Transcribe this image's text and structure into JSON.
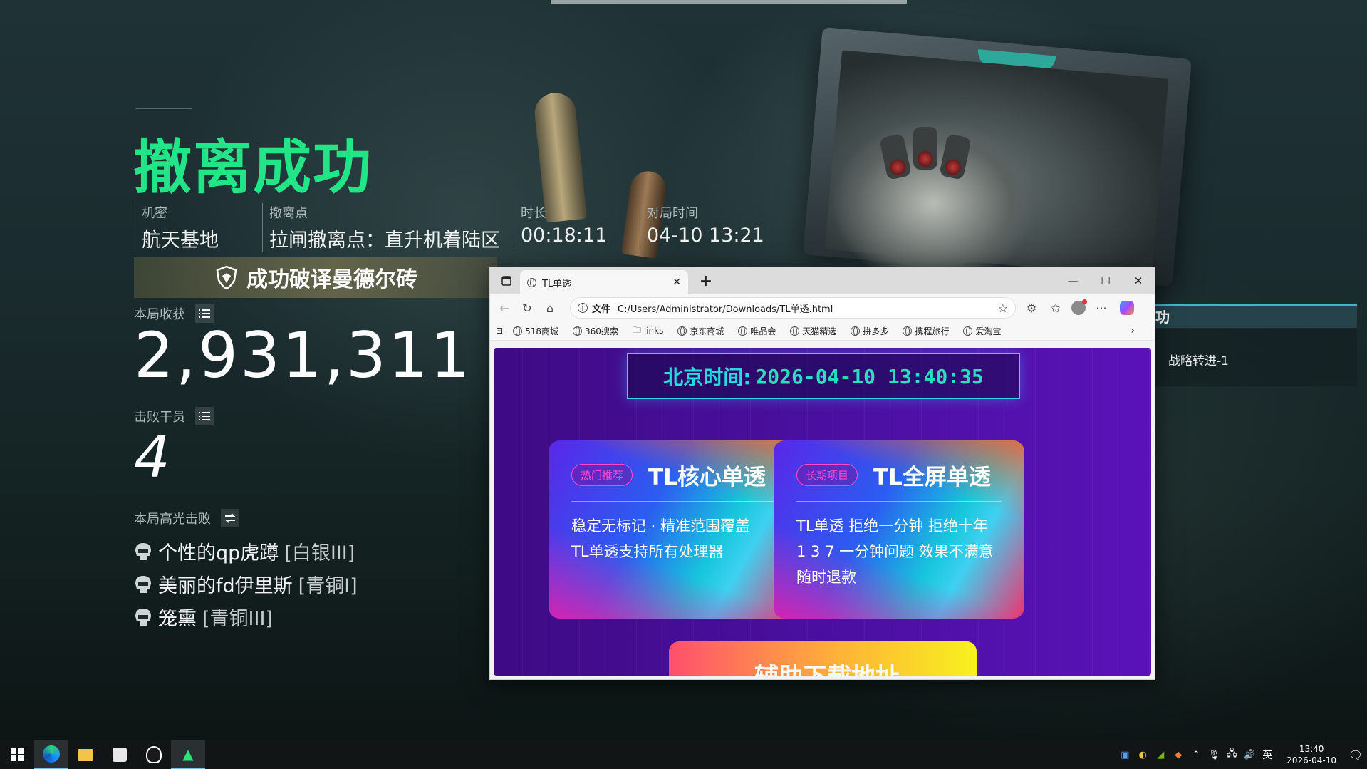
{
  "game": {
    "title": "撤离成功",
    "meta": [
      {
        "label": "机密",
        "value": "航天基地"
      },
      {
        "label": "撤离点",
        "value": "拉闸撤离点：直升机着陆区"
      },
      {
        "label": "时长",
        "value": "00:18:11"
      },
      {
        "label": "对局时间",
        "value": "04-10 13:21"
      }
    ],
    "banner": "成功破译曼德尔砖",
    "earnings_label": "本局收获",
    "earnings_value": "2,931,311",
    "kills_label": "击败干员",
    "kills_value": "4",
    "highlights_label": "本局高光击败",
    "highlights": [
      {
        "name": "个性的qp虎蹲",
        "rank": "[白银III]"
      },
      {
        "name": "美丽的fd伊里斯",
        "rank": "[青铜I]"
      },
      {
        "name": "笼熏",
        "rank": "[青铜III]"
      }
    ],
    "right_panel_title": "功",
    "right_panel_item": "战略转进-1"
  },
  "browser": {
    "tab_title": "TL单透",
    "url_prefix": "文件",
    "url": "C:/Users/Administrator/Downloads/TL单透.html",
    "bookmarks": [
      "518商城",
      "360搜索",
      "links",
      "京东商城",
      "唯品会",
      "天猫精选",
      "拼多多",
      "携程旅行",
      "爱淘宝"
    ],
    "page": {
      "clock_label": "北京时间:",
      "clock_value": "2026-04-10 13:40:35",
      "cards": [
        {
          "badge": "热门推荐",
          "title": "TL核心单透",
          "lines": [
            "稳定无标记 · 精准范围覆盖",
            "TL单透支持所有处理器"
          ]
        },
        {
          "badge": "长期项目",
          "title": "TL全屏单透",
          "lines": [
            "TL单透 拒绝一分钟 拒绝十年",
            "1 3 7 一分钟问题 效果不满意",
            "随时退款"
          ]
        }
      ],
      "download_button": "辅助下载地址"
    }
  },
  "taskbar": {
    "ime": "英",
    "time": "13:40",
    "date": "2026-04-10"
  },
  "colors": {
    "title_green": "#22e588",
    "clock_cyan": "#28d9e0",
    "page_purple": "#4a0fa0"
  }
}
